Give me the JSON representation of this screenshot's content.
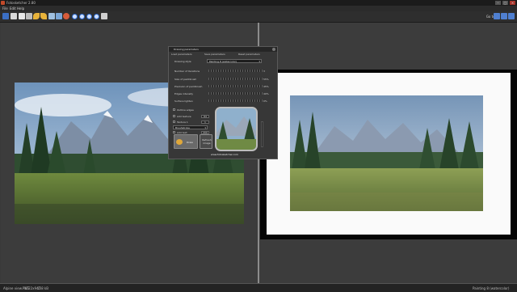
{
  "window": {
    "title": "Fotosketcher 2.80",
    "minimize": "–",
    "maximize": "□",
    "close": "×"
  },
  "menu": [
    "File",
    "Edit",
    "Help"
  ],
  "toolbar": {
    "icons": [
      "new-icon",
      "open-icon",
      "save-icon",
      "copy-icon",
      "undo-icon",
      "redo-icon",
      "gallery-icon",
      "film-icon",
      "settings-icon",
      "print-icon",
      "info-icon",
      "help-icon",
      "about-icon",
      "exit-icon"
    ],
    "goto_label": "Go to:",
    "presets": [
      "walker-icon",
      "walker-icon",
      "walker-icon",
      "walker-icon"
    ]
  },
  "dialog": {
    "title": "Drawing parameters",
    "tabs": [
      "Load parameters",
      "Save parameters",
      "Reset parameters"
    ],
    "drawing_style_label": "Drawing style",
    "drawing_style_value": "Painting 8 (watercolor)",
    "sliders": [
      {
        "label": "Number of iterations",
        "value": "3"
      },
      {
        "label": "Size of paintbrush",
        "value": "55%"
      },
      {
        "label": "Precision of paintbrush",
        "value": "45%"
      },
      {
        "label": "Edges intensity",
        "value": "40%"
      },
      {
        "label": "Surface lighten",
        "value": "0%"
      }
    ],
    "outline_edges_label": "Outline edges",
    "add_texture_label": "Add texture",
    "add_texture_value": "64",
    "texture_label": "Texture 1",
    "texture_value": "1",
    "texture_type": "Brushstroke",
    "add_text_label": "Add text",
    "add_text_value": "200",
    "draw_button": "Draw",
    "refresh_button": "Refresh image",
    "website": "www.fotosketcher.com"
  },
  "status": {
    "left": "Alpine view.PNG",
    "size": "1722x947",
    "memory": "158 kB",
    "right": "Painting 8 (watercolor)"
  },
  "colors": {
    "accent_close": "#a8352b",
    "panel": "#3c3c3c",
    "toolbar": "#2e2e2e"
  }
}
